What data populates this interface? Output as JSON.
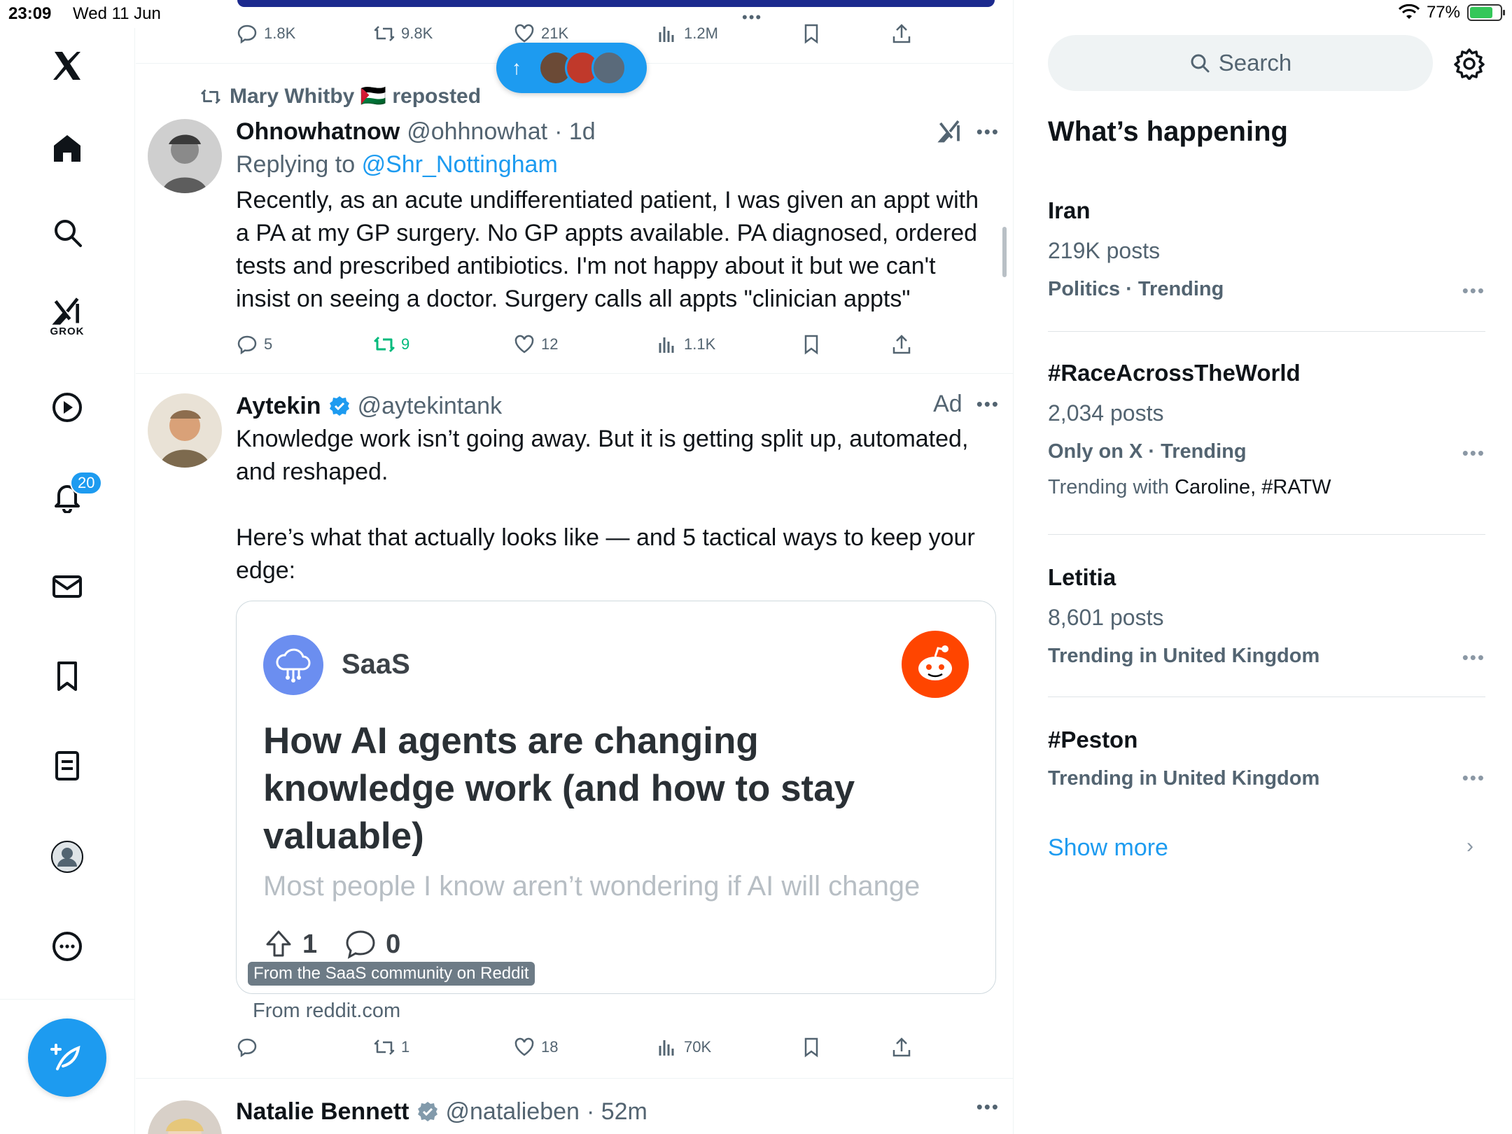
{
  "status_bar": {
    "time": "23:09",
    "date": "Wed 11 Jun",
    "battery": "77%",
    "battery_level": 0.77
  },
  "nav": {
    "grok_label": "GROK",
    "notifications_badge": "20"
  },
  "feed": {
    "prev_actions": {
      "replies": "1.8K",
      "reposts": "9.8K",
      "likes": "21K",
      "views": "1.2M"
    },
    "tweet1": {
      "repost_by": "Mary Whitby 🇵🇸 reposted",
      "name": "Ohnowhatnow",
      "handle": "@ohhnowhat",
      "time": "· 1d",
      "replying_prefix": "Replying to",
      "replying_to": "@Shr_Nottingham",
      "text": "Recently, as an acute undifferentiated patient, I was given an appt with a PA at my GP surgery. No GP appts available. PA diagnosed, ordered tests and prescribed antibiotics. I'm not happy about it but we can't insist on seeing a doctor. Surgery calls all appts \"clinician appts\"",
      "replies": "5",
      "reposts": "9",
      "likes": "12",
      "views": "1.1K"
    },
    "tweet2": {
      "name": "Aytekin",
      "handle": "@aytekintank",
      "ad_label": "Ad",
      "text": "Knowledge work isn’t going away. But it is getting split up, automated, and reshaped.\n\nHere’s what that actually looks like — and 5 tactical ways to keep your edge:",
      "card": {
        "subreddit": "SaaS",
        "title": "How AI agents are changing knowledge work (and how to stay valuable)",
        "snippet": "Most people I know aren’t wondering if AI will change",
        "upvotes": "1",
        "comments": "0",
        "caption": "From the SaaS community on Reddit"
      },
      "from": "From reddit.com",
      "replies": "",
      "reposts": "1",
      "likes": "18",
      "views": "70K"
    },
    "tweet3": {
      "name": "Natalie Bennett",
      "handle": "@natalieben",
      "time": "· 52m"
    }
  },
  "sidebar": {
    "search_placeholder": "Search",
    "title": "What’s happening",
    "trends": [
      {
        "title": "Iran",
        "count": "219K posts",
        "category": "Politics · Trending",
        "with": ""
      },
      {
        "title": "#RaceAcrossTheWorld",
        "count": "2,034 posts",
        "category": "Only on X · Trending",
        "with_prefix": "Trending with",
        "with": "Caroline, #RATW"
      },
      {
        "title": "Letitia",
        "count": "8,601 posts",
        "category": "Trending in United Kingdom",
        "with": ""
      },
      {
        "title": "#Peston",
        "count": "",
        "category": "Trending in United Kingdom",
        "with": ""
      }
    ],
    "show_more": "Show more"
  },
  "colors": {
    "accent": "#1d9bf0",
    "repost_green": "#00ba7c",
    "reddit": "#ff4500"
  }
}
